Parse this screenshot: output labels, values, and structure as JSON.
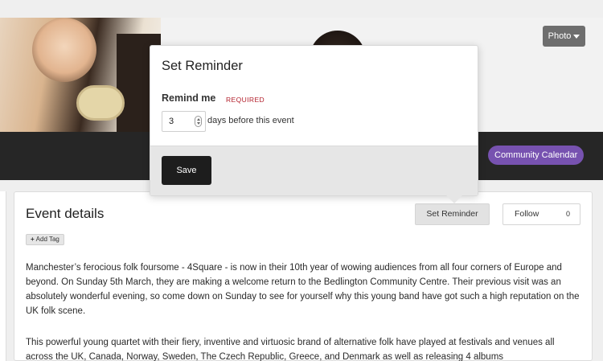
{
  "banner": {
    "photo_button_label": "Photo",
    "community_label": "Community Calendar"
  },
  "popover": {
    "title": "Set Reminder",
    "remind_label": "Remind me",
    "required_label": "REQUIRED",
    "days_value": "3",
    "days_suffix": "days before this event",
    "save_label": "Save"
  },
  "event": {
    "title": "Event details",
    "add_tag_label": "Add Tag",
    "set_reminder_label": "Set Reminder",
    "follow_label": "Follow",
    "follow_count": "0",
    "paragraphs": [
      "Manchester’s ferocious folk foursome - 4Square - is now in their 10th year of wowing audiences from all four corners of Europe and beyond. On Sunday 5th March, they are making a welcome return to the Bedlington Community Centre. Their previous visit was an absolutely wonderful evening, so come down on Sunday to see for yourself why this young band have got such a high reputation on the UK folk scene.",
      "This powerful young quartet with their fiery, inventive and virtuosic brand of alternative folk have played at festivals and venues all across the UK, Canada, Norway, Sweden, The Czech Republic, Greece, and Denmark as well as releasing 4 albums"
    ]
  },
  "colors": {
    "community_pill": "#7752b0",
    "required": "#b3202c",
    "save_button": "#1d1d1d",
    "dark_band": "#262626"
  },
  "icons": {
    "photo_caret": "caret-down-icon",
    "add_tag": "plus-icon",
    "spinner": "number-spinner-icon"
  }
}
